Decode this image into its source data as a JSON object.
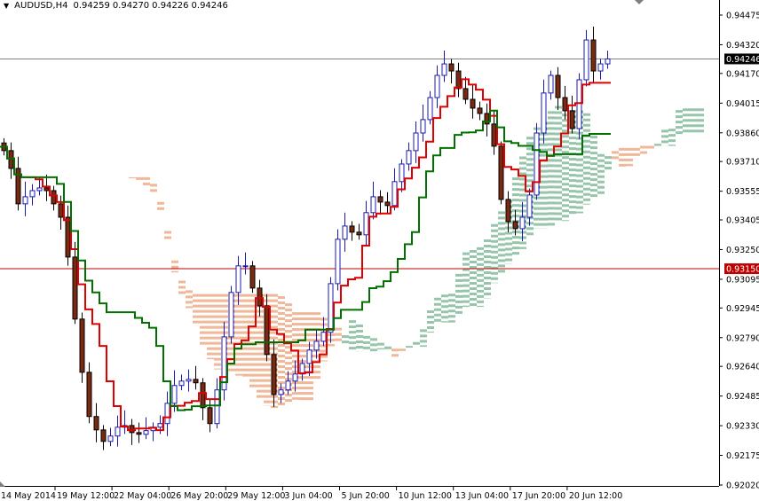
{
  "header": {
    "symbol": "AUDUSD,H4",
    "open": "0.94259",
    "high": "0.94270",
    "low": "0.94226",
    "close": "0.94246"
  },
  "colors": {
    "bull_outline": "#1a1ab0",
    "bear_body": "#7a2a10",
    "tenkan": "#e00000",
    "kijun": "#007000",
    "cloud_up": "#2e8b57",
    "cloud_down": "#e07030",
    "bid_line": "#7f7f7f",
    "level_line": "#c00000"
  },
  "chart_data": {
    "type": "candlestick",
    "title": "AUDUSD,H4",
    "indicators": [
      "Ichimoku Tenkan-sen",
      "Ichimoku Kijun-sen",
      "Ichimoku Kumo cloud"
    ],
    "ylim": [
      0.9202,
      0.94475
    ],
    "y_ticks": [
      "0.94475",
      "0.94320",
      "0.94170",
      "0.94015",
      "0.93860",
      "0.93710",
      "0.93555",
      "0.93405",
      "0.93250",
      "0.93095",
      "0.92945",
      "0.92790",
      "0.92640",
      "0.92485",
      "0.92330",
      "0.92175",
      "0.92020"
    ],
    "x_ticks": [
      "14 May 2014",
      "19 May 12:00",
      "22 May 04:00",
      "26 May 20:00",
      "29 May 12:00",
      "3 Jun 04:00",
      "5 Jun 20:00",
      "10 Jun 12:00",
      "13 Jun 04:00",
      "17 Jun 20:00",
      "20 Jun 12:00"
    ],
    "current_price": {
      "value": 0.94246,
      "label": "0.94246"
    },
    "level_line": {
      "value": 0.9315,
      "label": "0.93150"
    },
    "closes": [
      0.93767,
      0.93674,
      0.93489,
      0.93526,
      0.93558,
      0.93572,
      0.93558,
      0.93489,
      0.93419,
      0.93211,
      0.92887,
      0.92609,
      0.92378,
      0.92308,
      0.92248,
      0.92276,
      0.92322,
      0.92331,
      0.92294,
      0.92285,
      0.92304,
      0.92322,
      0.92341,
      0.92447,
      0.9254,
      0.92563,
      0.92572,
      0.92554,
      0.92424,
      0.92341,
      0.92517,
      0.92794,
      0.93026,
      0.93165,
      0.93165,
      0.93049,
      0.92956,
      0.92702,
      0.92493,
      0.92517,
      0.92563,
      0.926,
      0.92655,
      0.92725,
      0.92771,
      0.92818,
      0.93072,
      0.93304,
      0.93373,
      0.93341,
      0.93327,
      0.93443,
      0.93526,
      0.93498,
      0.9348,
      0.93605,
      0.93697,
      0.93767,
      0.93859,
      0.93929,
      0.94044,
      0.9416,
      0.9422,
      0.94183,
      0.94091,
      0.94035,
      0.93989,
      0.93961,
      0.93906,
      0.9379,
      0.93512,
      0.93396,
      0.93359,
      0.93419,
      0.93535,
      0.93859,
      0.94068,
      0.9416,
      0.94044,
      0.93975,
      0.93882,
      0.94137,
      0.94345,
      0.94183,
      0.9422,
      0.94246
    ]
  }
}
